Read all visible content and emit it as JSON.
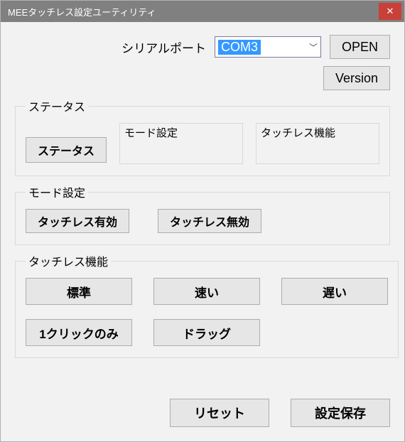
{
  "title": "MEEタッチレス設定ユーティリティ",
  "close_glyph": "✕",
  "serial": {
    "label": "シリアルポート",
    "value": "COM3"
  },
  "buttons": {
    "open": "OPEN",
    "version": "Version",
    "status": "ステータス",
    "reset": "リセット",
    "save": "設定保存"
  },
  "groups": {
    "status": "ステータス",
    "mode": "モード設定",
    "func": "タッチレス機能"
  },
  "status_boxes": {
    "mode": "モード設定",
    "func": "タッチレス機能"
  },
  "mode_buttons": {
    "enable": "タッチレス有効",
    "disable": "タッチレス無効"
  },
  "func_buttons": {
    "standard": "標準",
    "fast": "速い",
    "slow": "遅い",
    "oneclick": "1クリックのみ",
    "drag": "ドラッグ"
  }
}
